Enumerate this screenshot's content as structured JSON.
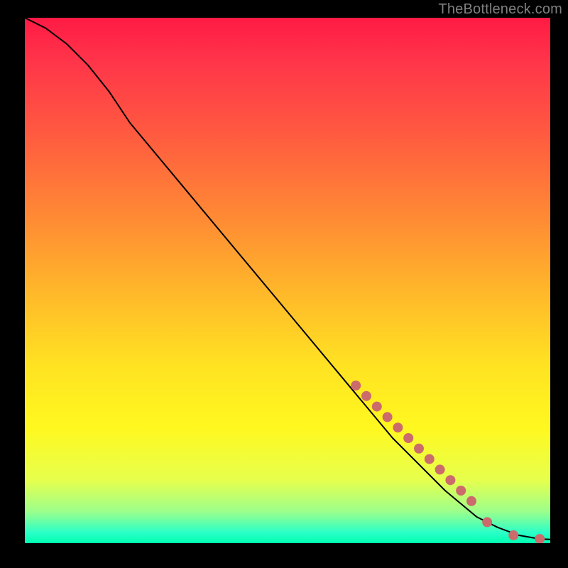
{
  "watermark": "TheBottleneck.com",
  "chart_data": {
    "type": "line",
    "title": "",
    "xlabel": "",
    "ylabel": "",
    "xlim": [
      0,
      100
    ],
    "ylim": [
      0,
      100
    ],
    "grid": false,
    "legend": false,
    "series": [
      {
        "name": "curve",
        "style": "line",
        "color": "#000000",
        "x": [
          0,
          4,
          8,
          12,
          16,
          20,
          30,
          40,
          50,
          60,
          70,
          80,
          86,
          90,
          94,
          98,
          100
        ],
        "y": [
          100,
          98,
          95,
          91,
          86,
          80,
          68,
          56,
          44,
          32,
          20,
          10,
          5,
          3,
          1.5,
          0.8,
          0.7
        ]
      },
      {
        "name": "highlight-dots",
        "style": "scatter",
        "color": "#cc6b6b",
        "x": [
          63,
          65,
          67,
          69,
          71,
          73,
          75,
          77,
          79,
          81,
          83,
          85,
          88,
          93,
          98
        ],
        "y": [
          30,
          28,
          26,
          24,
          22,
          20,
          18,
          16,
          14,
          12,
          10,
          8,
          4,
          1.5,
          0.8
        ]
      }
    ]
  }
}
